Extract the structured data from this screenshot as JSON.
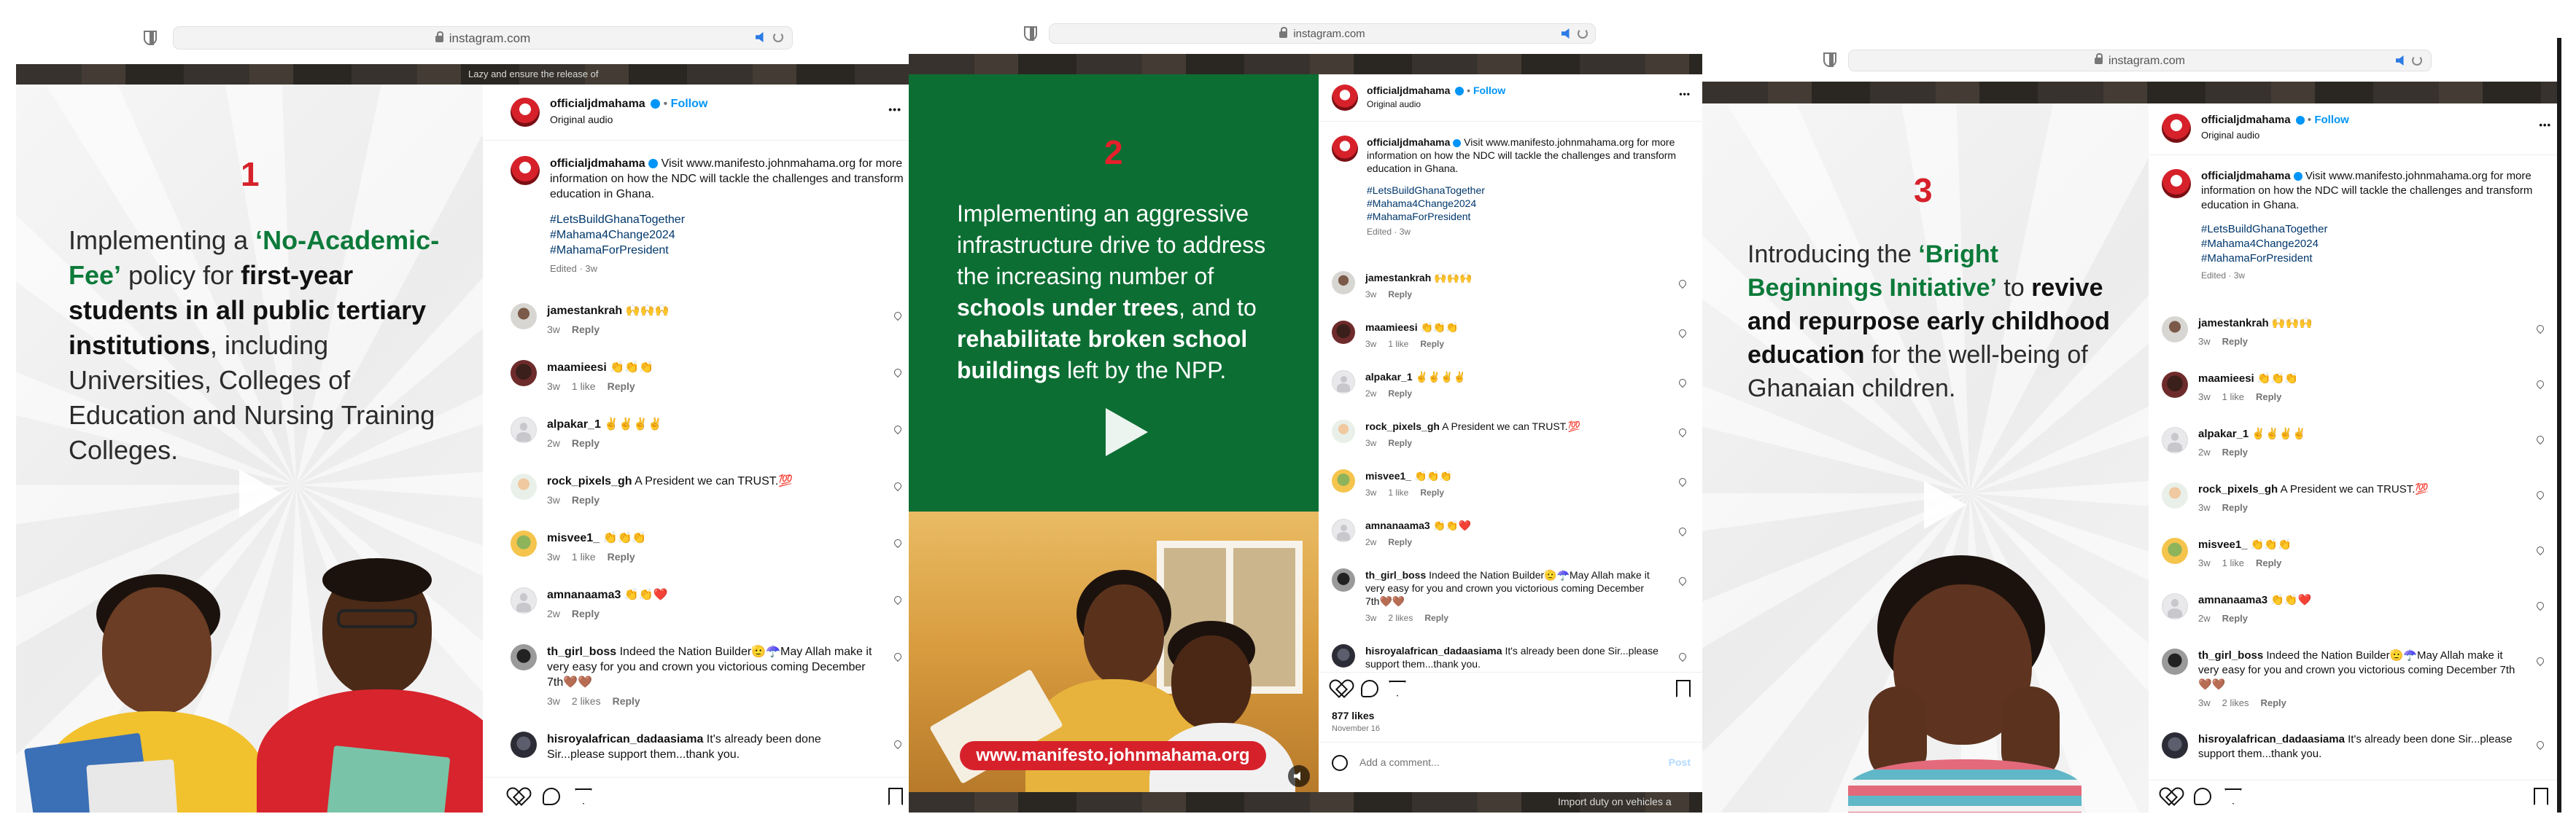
{
  "browser": {
    "url": "instagram.com",
    "strip_text_top": "Lazy and ensure the release of",
    "strip_text_bottom": "Import duty on vehicles a"
  },
  "post": {
    "username": "officialjdmahama",
    "follow_label": "Follow",
    "bullet": "•",
    "audio": "Original audio",
    "caption": "Visit www.manifesto.johnmahama.org for more information on how the NDC will tackle the challenges and transform education in Ghana.",
    "hashtags": [
      "#LetsBuildGhanaTogether",
      "#Mahama4Change2024",
      "#MahamaForPresident"
    ],
    "edited": "Edited · 3w",
    "likes": "877 likes",
    "date": "November 16",
    "add_comment_placeholder": "Add a comment...",
    "post_label": "Post",
    "more_icon": "•••"
  },
  "comments": [
    {
      "user": "jamestankrah",
      "text": "🙌🙌🙌",
      "time": "3w",
      "likes": "",
      "reply": "Reply",
      "avatar": "av1"
    },
    {
      "user": "maamieesi",
      "text": "👏👏👏",
      "time": "3w",
      "likes": "1 like",
      "reply": "Reply",
      "avatar": "av2"
    },
    {
      "user": "alpakar_1",
      "text": "✌️✌️✌️✌️",
      "time": "2w",
      "likes": "",
      "reply": "Reply",
      "avatar": "blank"
    },
    {
      "user": "rock_pixels_gh",
      "text": "A President we can TRUST.💯",
      "time": "3w",
      "likes": "",
      "reply": "Reply",
      "avatar": "av3"
    },
    {
      "user": "misvee1_",
      "text": "👏👏👏",
      "time": "3w",
      "likes": "1 like",
      "reply": "Reply",
      "avatar": "av4"
    },
    {
      "user": "amnanaama3",
      "text": "👏👏❤️",
      "time": "2w",
      "likes": "",
      "reply": "Reply",
      "avatar": "blank"
    },
    {
      "user": "th_girl_boss",
      "text": "Indeed the Nation Builder🫡☂️May Allah make it very easy for you and crown you victorious coming December 7th🤎🤎",
      "time": "3w",
      "likes": "2 likes",
      "reply": "Reply",
      "avatar": "av5"
    },
    {
      "user": "hisroyalafrican_dadaasiama",
      "text": "It's already been done Sir...please support them...thank you.",
      "time": "",
      "likes": "",
      "reply": "",
      "avatar": "av6"
    }
  ],
  "slides": [
    {
      "number": "1",
      "parts": [
        {
          "t": "Implementing a ",
          "s": "n"
        },
        {
          "t": "‘No-Academic-Fee’",
          "s": "g"
        },
        {
          "t": " policy for ",
          "s": "n"
        },
        {
          "t": "first-year students in all public tertiary institutions",
          "s": "b"
        },
        {
          "t": ", including Universities, Colleges of Education and Nursing Training Colleges.",
          "s": "n"
        }
      ]
    },
    {
      "number": "2",
      "parts": [
        {
          "t": "Implementing an aggressive infrastructure drive to address the increasing number of ",
          "s": "n"
        },
        {
          "t": "schools under trees",
          "s": "b"
        },
        {
          "t": ", and to ",
          "s": "n"
        },
        {
          "t": "rehabilitate broken school buildings",
          "s": "b"
        },
        {
          "t": " left by the NPP.",
          "s": "n"
        }
      ],
      "url_banner": "www.manifesto.johnmahama.org"
    },
    {
      "number": "3",
      "parts": [
        {
          "t": "Introducing the ",
          "s": "n"
        },
        {
          "t": "‘Bright Beginnings Initiative’",
          "s": "g"
        },
        {
          "t": " to ",
          "s": "n"
        },
        {
          "t": "revive and repurpose early childhood education",
          "s": "b"
        },
        {
          "t": " for the well-being of Ghanaian children.",
          "s": "n"
        }
      ]
    }
  ]
}
